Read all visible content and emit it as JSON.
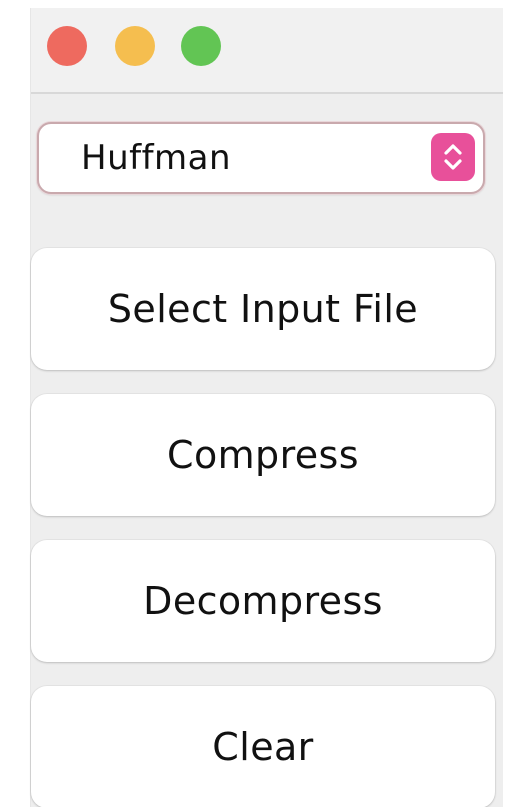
{
  "window": {
    "controls": {
      "close_color": "#ee6a5f",
      "minimize_color": "#f5be4f",
      "zoom_color": "#62c554"
    }
  },
  "algorithm_select": {
    "selected": "Huffman",
    "accent_color": "#e8509a",
    "icon": "updown-chevron-icon"
  },
  "buttons": {
    "select_input_file": "Select Input File",
    "compress": "Compress",
    "decompress": "Decompress",
    "clear": "Clear"
  }
}
